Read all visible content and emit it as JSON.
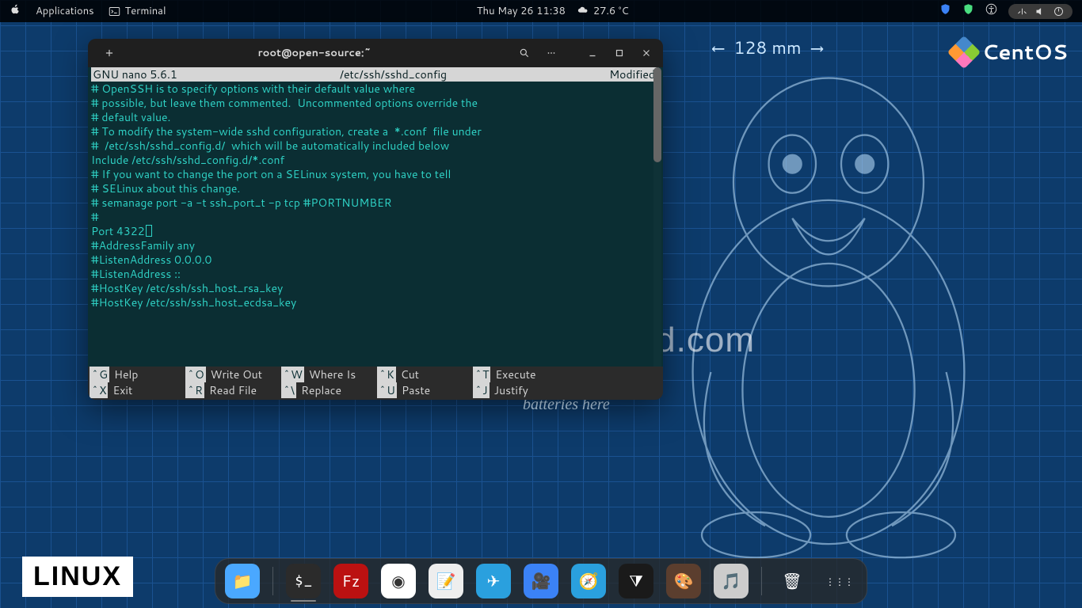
{
  "topbar": {
    "applications": "Applications",
    "terminal_label": "Terminal",
    "datetime": "Thu May 26  11:38",
    "temperature": "27.6 °C"
  },
  "window": {
    "title": "root@open-source:~"
  },
  "nano": {
    "app": "  GNU nano 5.6.1",
    "file": "/etc/ssh/sshd_config",
    "status": "Modified",
    "lines": [
      "# OpenSSH is to specify options with their default value where",
      "# possible, but leave them commented.  Uncommented options override the",
      "# default value.",
      "",
      "# To modify the system-wide sshd configuration, create a  *.conf  file under",
      "#  /etc/ssh/sshd_config.d/  which will be automatically included below",
      "Include /etc/ssh/sshd_config.d/*.conf",
      "",
      "# If you want to change the port on a SELinux system, you have to tell",
      "# SELinux about this change.",
      "# semanage port -a -t ssh_port_t -p tcp #PORTNUMBER",
      "#",
      "Port 4322",
      "#AddressFamily any",
      "#ListenAddress 0.0.0.0",
      "#ListenAddress ::",
      "",
      "#HostKey /etc/ssh/ssh_host_rsa_key",
      "#HostKey /etc/ssh/ssh_host_ecdsa_key"
    ],
    "cursor_line_index": 12,
    "shortcuts": [
      {
        "key": "^G",
        "label": "Help"
      },
      {
        "key": "^O",
        "label": "Write Out"
      },
      {
        "key": "^W",
        "label": "Where Is"
      },
      {
        "key": "^K",
        "label": "Cut"
      },
      {
        "key": "^T",
        "label": "Execute"
      },
      {
        "key": "^X",
        "label": "Exit"
      },
      {
        "key": "^R",
        "label": "Read File"
      },
      {
        "key": "^\\",
        "label": "Replace"
      },
      {
        "key": "^U",
        "label": "Paste"
      },
      {
        "key": "^J",
        "label": "Justify"
      }
    ]
  },
  "desktop": {
    "watermark": "fcgid.com",
    "measure": "128 mm",
    "batteries": "batteries here",
    "centos": "CentOS",
    "linux_badge": "LINUX"
  },
  "dock": [
    {
      "name": "files",
      "color": "#4aa8ff",
      "glyph": "📁"
    },
    {
      "name": "terminal",
      "color": "#2b2b2b",
      "glyph": "$_",
      "active": true
    },
    {
      "name": "filezilla",
      "color": "#b11",
      "glyph": "Fz"
    },
    {
      "name": "chrome",
      "color": "#fff",
      "glyph": "◉"
    },
    {
      "name": "text-editor",
      "color": "#eee",
      "glyph": "📝"
    },
    {
      "name": "telegram",
      "color": "#2aa0de",
      "glyph": "✈"
    },
    {
      "name": "zoom",
      "color": "#3b82f6",
      "glyph": "🎥"
    },
    {
      "name": "safari",
      "color": "#2aa0de",
      "glyph": "🧭"
    },
    {
      "name": "vscode",
      "color": "#1a1a1a",
      "glyph": "⧩"
    },
    {
      "name": "gimp",
      "color": "#5b3e2e",
      "glyph": "🎨"
    },
    {
      "name": "music",
      "color": "#ccc",
      "glyph": "🎵"
    },
    {
      "name": "trash",
      "color": "transparent",
      "glyph": "🗑"
    },
    {
      "name": "apps-grid",
      "color": "transparent",
      "glyph": "⋮⋮⋮"
    }
  ]
}
